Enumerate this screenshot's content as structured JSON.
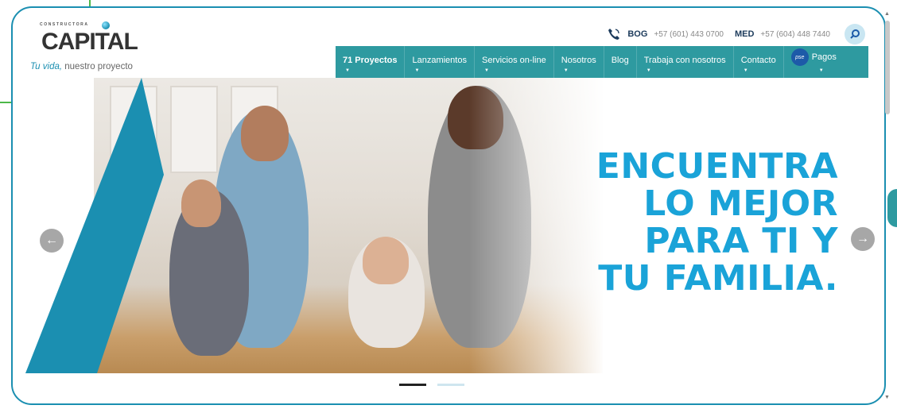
{
  "brand": {
    "small": "CONSTRUCTORA",
    "name": "CAPITAL",
    "tagline_em": "Tu vida,",
    "tagline_rest": " nuestro proyecto"
  },
  "contact": [
    {
      "city": "BOG",
      "phone": "+57 (601) 443 0700"
    },
    {
      "city": "MED",
      "phone": "+57 (604) 448 7440"
    }
  ],
  "icons": {
    "phone": "phone-icon",
    "search": "search-icon",
    "prev": "arrow-left-icon",
    "next": "arrow-right-icon"
  },
  "nav": {
    "items": [
      {
        "label": "71 Proyectos"
      },
      {
        "label": "Lanzamientos"
      },
      {
        "label": "Servicios on-line"
      },
      {
        "label": "Nosotros"
      },
      {
        "label": "Blog"
      },
      {
        "label": "Trabaja con nosotros"
      },
      {
        "label": "Contacto"
      },
      {
        "label": "Pagos"
      }
    ],
    "pse": "pse"
  },
  "hero": {
    "line1": "ENCUENTRA",
    "line2": "LO MEJOR",
    "line3": "PARA TI Y",
    "line4": "TU FAMILIA."
  },
  "carousel": {
    "slides": 2,
    "active": 1
  },
  "colors": {
    "accent": "#1b8fb1",
    "nav": "#2e9aa0",
    "headline": "#1aa3d8",
    "green": "#4cb848"
  }
}
